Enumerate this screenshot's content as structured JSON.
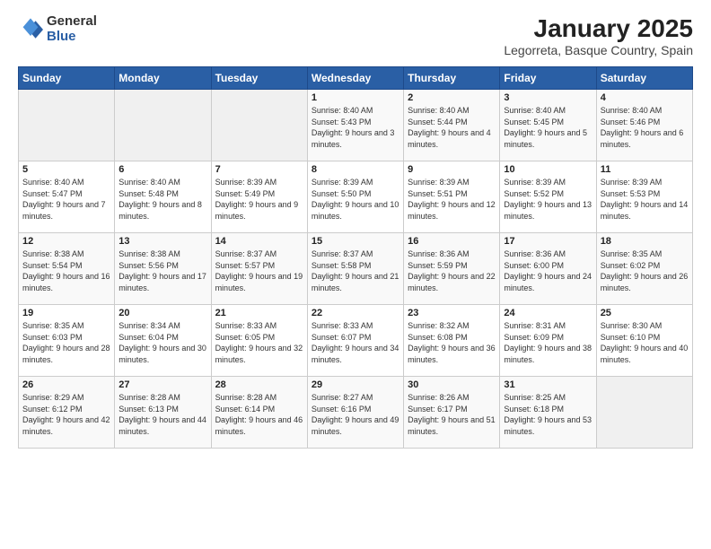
{
  "logo": {
    "general": "General",
    "blue": "Blue"
  },
  "title": "January 2025",
  "subtitle": "Legorreta, Basque Country, Spain",
  "weekdays": [
    "Sunday",
    "Monday",
    "Tuesday",
    "Wednesday",
    "Thursday",
    "Friday",
    "Saturday"
  ],
  "weeks": [
    [
      {
        "day": "",
        "info": ""
      },
      {
        "day": "",
        "info": ""
      },
      {
        "day": "",
        "info": ""
      },
      {
        "day": "1",
        "info": "Sunrise: 8:40 AM\nSunset: 5:43 PM\nDaylight: 9 hours and 3 minutes."
      },
      {
        "day": "2",
        "info": "Sunrise: 8:40 AM\nSunset: 5:44 PM\nDaylight: 9 hours and 4 minutes."
      },
      {
        "day": "3",
        "info": "Sunrise: 8:40 AM\nSunset: 5:45 PM\nDaylight: 9 hours and 5 minutes."
      },
      {
        "day": "4",
        "info": "Sunrise: 8:40 AM\nSunset: 5:46 PM\nDaylight: 9 hours and 6 minutes."
      }
    ],
    [
      {
        "day": "5",
        "info": "Sunrise: 8:40 AM\nSunset: 5:47 PM\nDaylight: 9 hours and 7 minutes."
      },
      {
        "day": "6",
        "info": "Sunrise: 8:40 AM\nSunset: 5:48 PM\nDaylight: 9 hours and 8 minutes."
      },
      {
        "day": "7",
        "info": "Sunrise: 8:39 AM\nSunset: 5:49 PM\nDaylight: 9 hours and 9 minutes."
      },
      {
        "day": "8",
        "info": "Sunrise: 8:39 AM\nSunset: 5:50 PM\nDaylight: 9 hours and 10 minutes."
      },
      {
        "day": "9",
        "info": "Sunrise: 8:39 AM\nSunset: 5:51 PM\nDaylight: 9 hours and 12 minutes."
      },
      {
        "day": "10",
        "info": "Sunrise: 8:39 AM\nSunset: 5:52 PM\nDaylight: 9 hours and 13 minutes."
      },
      {
        "day": "11",
        "info": "Sunrise: 8:39 AM\nSunset: 5:53 PM\nDaylight: 9 hours and 14 minutes."
      }
    ],
    [
      {
        "day": "12",
        "info": "Sunrise: 8:38 AM\nSunset: 5:54 PM\nDaylight: 9 hours and 16 minutes."
      },
      {
        "day": "13",
        "info": "Sunrise: 8:38 AM\nSunset: 5:56 PM\nDaylight: 9 hours and 17 minutes."
      },
      {
        "day": "14",
        "info": "Sunrise: 8:37 AM\nSunset: 5:57 PM\nDaylight: 9 hours and 19 minutes."
      },
      {
        "day": "15",
        "info": "Sunrise: 8:37 AM\nSunset: 5:58 PM\nDaylight: 9 hours and 21 minutes."
      },
      {
        "day": "16",
        "info": "Sunrise: 8:36 AM\nSunset: 5:59 PM\nDaylight: 9 hours and 22 minutes."
      },
      {
        "day": "17",
        "info": "Sunrise: 8:36 AM\nSunset: 6:00 PM\nDaylight: 9 hours and 24 minutes."
      },
      {
        "day": "18",
        "info": "Sunrise: 8:35 AM\nSunset: 6:02 PM\nDaylight: 9 hours and 26 minutes."
      }
    ],
    [
      {
        "day": "19",
        "info": "Sunrise: 8:35 AM\nSunset: 6:03 PM\nDaylight: 9 hours and 28 minutes."
      },
      {
        "day": "20",
        "info": "Sunrise: 8:34 AM\nSunset: 6:04 PM\nDaylight: 9 hours and 30 minutes."
      },
      {
        "day": "21",
        "info": "Sunrise: 8:33 AM\nSunset: 6:05 PM\nDaylight: 9 hours and 32 minutes."
      },
      {
        "day": "22",
        "info": "Sunrise: 8:33 AM\nSunset: 6:07 PM\nDaylight: 9 hours and 34 minutes."
      },
      {
        "day": "23",
        "info": "Sunrise: 8:32 AM\nSunset: 6:08 PM\nDaylight: 9 hours and 36 minutes."
      },
      {
        "day": "24",
        "info": "Sunrise: 8:31 AM\nSunset: 6:09 PM\nDaylight: 9 hours and 38 minutes."
      },
      {
        "day": "25",
        "info": "Sunrise: 8:30 AM\nSunset: 6:10 PM\nDaylight: 9 hours and 40 minutes."
      }
    ],
    [
      {
        "day": "26",
        "info": "Sunrise: 8:29 AM\nSunset: 6:12 PM\nDaylight: 9 hours and 42 minutes."
      },
      {
        "day": "27",
        "info": "Sunrise: 8:28 AM\nSunset: 6:13 PM\nDaylight: 9 hours and 44 minutes."
      },
      {
        "day": "28",
        "info": "Sunrise: 8:28 AM\nSunset: 6:14 PM\nDaylight: 9 hours and 46 minutes."
      },
      {
        "day": "29",
        "info": "Sunrise: 8:27 AM\nSunset: 6:16 PM\nDaylight: 9 hours and 49 minutes."
      },
      {
        "day": "30",
        "info": "Sunrise: 8:26 AM\nSunset: 6:17 PM\nDaylight: 9 hours and 51 minutes."
      },
      {
        "day": "31",
        "info": "Sunrise: 8:25 AM\nSunset: 6:18 PM\nDaylight: 9 hours and 53 minutes."
      },
      {
        "day": "",
        "info": ""
      }
    ]
  ]
}
